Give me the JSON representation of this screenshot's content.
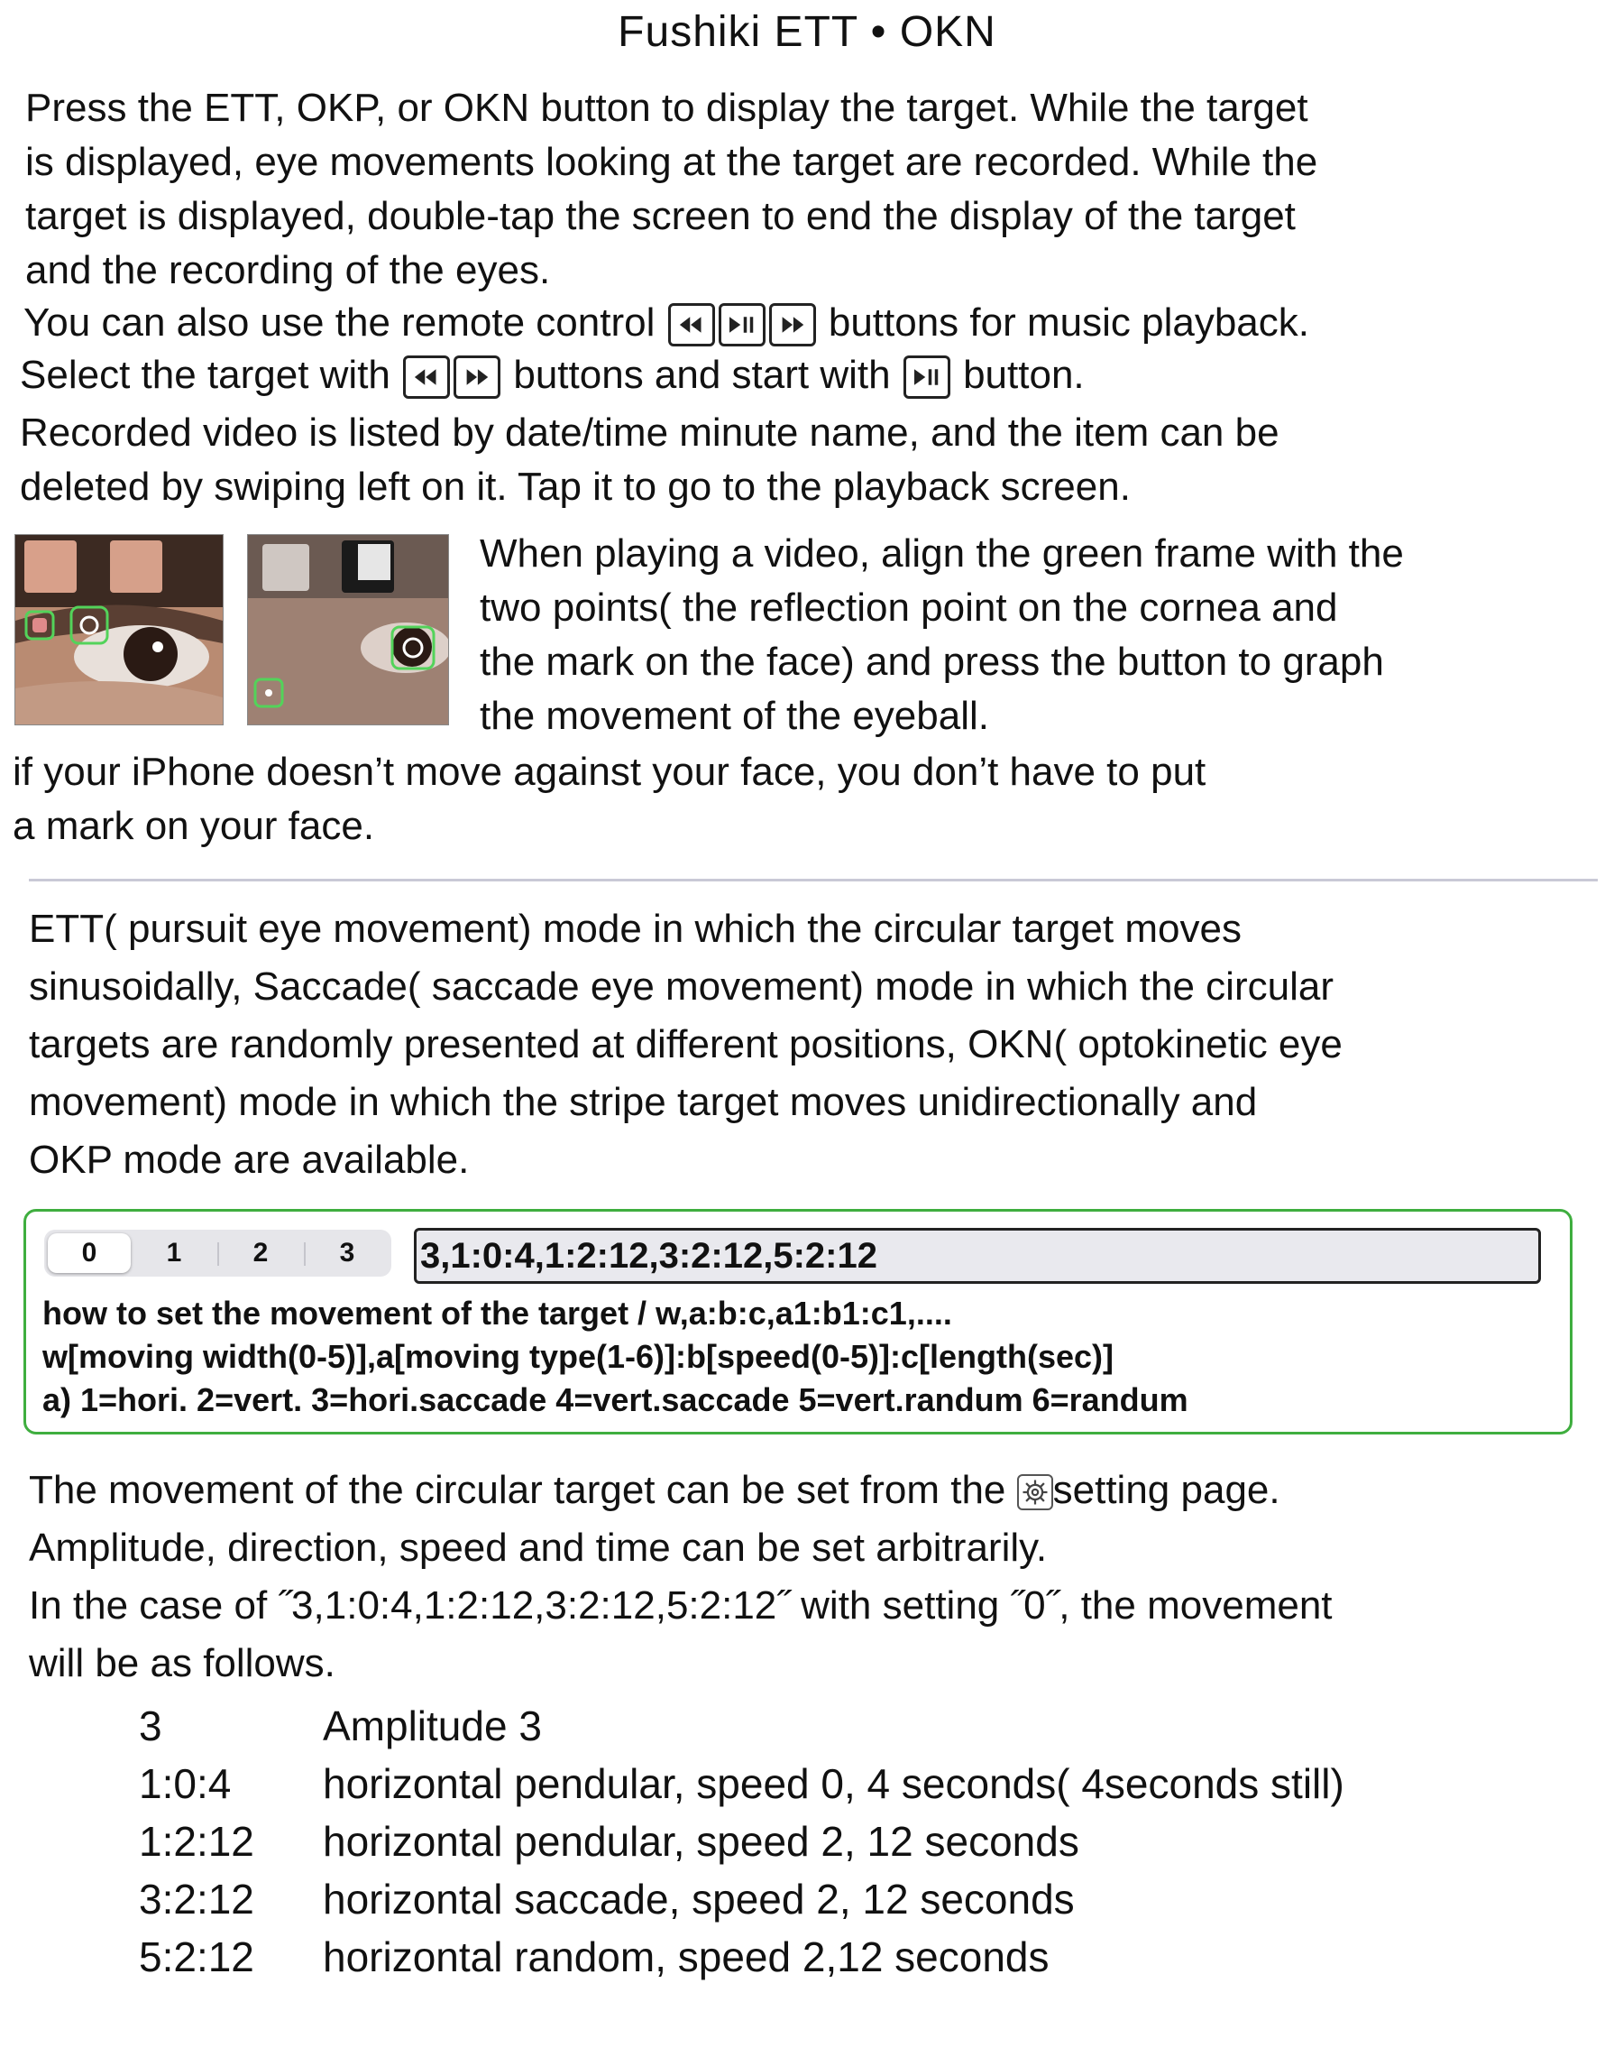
{
  "title": "Fushiki ETT • OKN",
  "intro": {
    "line1": "Press the ETT, OKP, or OKN button to display the target.  While the target",
    "line2": "is displayed, eye movements looking at the target are recorded.  While the",
    "line3": "target is displayed, double-tap the screen to end the display of the target",
    "line4": "and the recording of the eyes.",
    "line5_pre": "You can also use the remote control",
    "line5_post": "buttons for music playback.",
    "line6_pre": "Select the target with",
    "line6_mid": "buttons and start with",
    "line6_post": "button.",
    "line7": "Recorded video is listed by date/time minute name, and the item can be",
    "line8": "deleted by swiping left on it.  Tap it to go to the playback screen."
  },
  "video_help": {
    "line1": "When playing a video, align the green frame with the",
    "line2": "two points( the reflection point on the cornea and",
    "line3": "the mark on the face) and press the button to graph",
    "line4": "the movement of the eyeball."
  },
  "mark_note": {
    "line1": "if your iPhone doesn’t move against your face, you don’t have to put",
    "line2": "a mark on your face."
  },
  "modes": {
    "line1": "ETT( pursuit eye movement) mode in which the circular target moves",
    "line2": "sinusoidally, Saccade( saccade eye movement) mode in which the circular",
    "line3": "targets are randomly presented at different positions, OKN( optokinetic eye",
    "line4": "movement) mode in which the stripe target moves unidirectionally and",
    "line5": "OKP mode are available."
  },
  "settings_panel": {
    "segments": [
      "0",
      "1",
      "2",
      "3"
    ],
    "selected_segment": "0",
    "value": "3,1:0:4,1:2:12,3:2:12,5:2:12",
    "hint1": "how to set the movement of the target / w,a:b:c,a1:b1:c1,....",
    "hint2": "w[moving width(0-5)],a[moving type(1-6)]:b[speed(0-5)]:c[length(sec)]",
    "hint3": "a) 1=hori. 2=vert. 3=hori.saccade 4=vert.saccade 5=vert.randum 6=randum",
    "border_color": "#3fae3f"
  },
  "explanation": {
    "line1_pre": "The movement of the circular target can be set from the",
    "line1_post": "setting page.",
    "line2": "Amplitude, direction, speed and time can be set arbitrarily.",
    "line3": "In the case of ˝3,1:0:4,1:2:12,3:2:12,5:2:12˝ with setting ˝0˝, the movement",
    "line4": "will be as follows."
  },
  "example_rows": [
    {
      "code": "3",
      "desc": "Amplitude 3"
    },
    {
      "code": "1:0:4",
      "desc": "horizontal pendular, speed 0, 4 seconds( 4seconds still)"
    },
    {
      "code": "1:2:12",
      "desc": "horizontal pendular, speed 2, 12 seconds"
    },
    {
      "code": "3:2:12",
      "desc": "horizontal saccade, speed 2, 12 seconds"
    },
    {
      "code": "5:2:12",
      "desc": "horizontal random, speed 2,12 seconds"
    }
  ],
  "icons": {
    "rewind": "rewind-icon",
    "play_pause": "play-pause-icon",
    "fast_forward": "fast-forward-icon",
    "gear": "gear-icon"
  }
}
